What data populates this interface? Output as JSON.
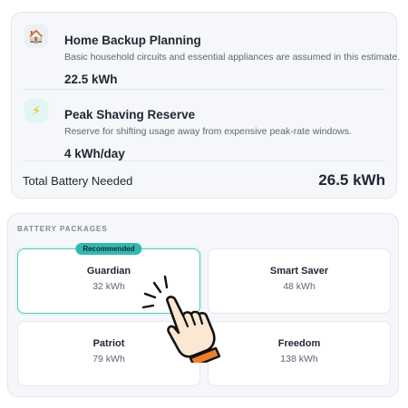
{
  "summary": {
    "items": [
      {
        "icon": "house-icon",
        "title": "Home Backup Planning",
        "description": "Basic household circuits and essential appliances are assumed in this estimate.",
        "value": "22.5 kWh"
      },
      {
        "icon": "lightning-bolt-icon",
        "title": "Peak Shaving Reserve",
        "description": "Reserve for shifting usage away from expensive peak-rate windows.",
        "value": "4 kWh/day"
      }
    ],
    "total_label": "Total Battery Needed",
    "total_value": "26.5 kWh"
  },
  "packages": {
    "heading": "BATTERY PACKAGES",
    "selected": "Guardian",
    "items": [
      {
        "name": "Guardian",
        "capacity": "32 kWh",
        "badge": "Recommended"
      },
      {
        "name": "Smart Saver",
        "capacity": "48 kWh"
      },
      {
        "name": "Patriot",
        "capacity": "79 kWh"
      },
      {
        "name": "Freedom",
        "capacity": "138 kWh"
      }
    ]
  },
  "colors": {
    "accent": "#35b8b0",
    "selected_border": "#5cc7c0",
    "pointer_cuff": "#f07d2a"
  }
}
